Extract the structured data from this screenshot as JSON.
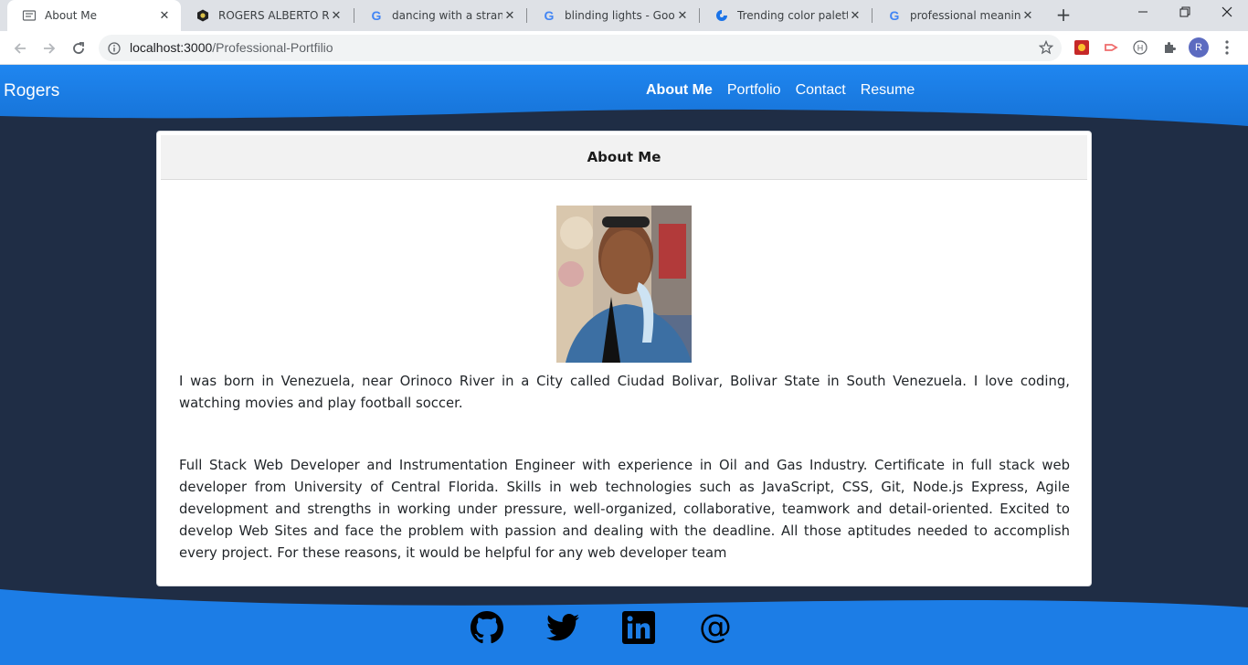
{
  "browser": {
    "tabs": [
      {
        "title": "About Me",
        "active": true,
        "favicon": "page-icon"
      },
      {
        "title": "ROGERS ALBERTO RAM",
        "active": false,
        "favicon": "hex-icon"
      },
      {
        "title": "dancing with a stranger",
        "active": false,
        "favicon": "google-icon"
      },
      {
        "title": "blinding lights - Google",
        "active": false,
        "favicon": "google-icon"
      },
      {
        "title": "Trending color palettes",
        "active": false,
        "favicon": "palette-icon"
      },
      {
        "title": "professional meaning -",
        "active": false,
        "favicon": "google-icon"
      }
    ],
    "new_tab": "+",
    "url_host": "localhost:3000",
    "url_path": "/Professional-Portfilio",
    "profile_initial": "R"
  },
  "site": {
    "brand": "Rogers",
    "nav": [
      {
        "label": "About Me",
        "current": true
      },
      {
        "label": "Portfolio",
        "current": false
      },
      {
        "label": "Contact",
        "current": false
      },
      {
        "label": "Resume",
        "current": false
      }
    ],
    "card_title": "About Me",
    "bio_paragraph": "I was born in Venezuela, near Orinoco River in a City called Ciudad Bolivar, Bolivar State in South Venezuela. I love coding, watching movies and play football soccer.",
    "profile_paragraph": "Full Stack Web Developer and Instrumentation Engineer with experience in Oil and Gas Industry. Certificate in full stack web developer from University of Central Florida. Skills in web technologies such as JavaScript, CSS, Git, Node.js Express, Agile development and strengths in working under pressure, well-organized, collaborative, teamwork and detail-oriented. Excited to develop Web Sites and face the problem with passion and dealing with the deadline. All those aptitudes needed to accomplish every project. For these reasons, it would be helpful for any web developer team",
    "social_icons": [
      "github-icon",
      "twitter-icon",
      "linkedin-icon",
      "at-email-icon"
    ],
    "email_symbol": "@"
  },
  "colors": {
    "header_blue": "#1a7fe8",
    "page_navy": "#1f2d45",
    "card_bg": "#ffffff",
    "footer_blue": "#1c7de6"
  }
}
